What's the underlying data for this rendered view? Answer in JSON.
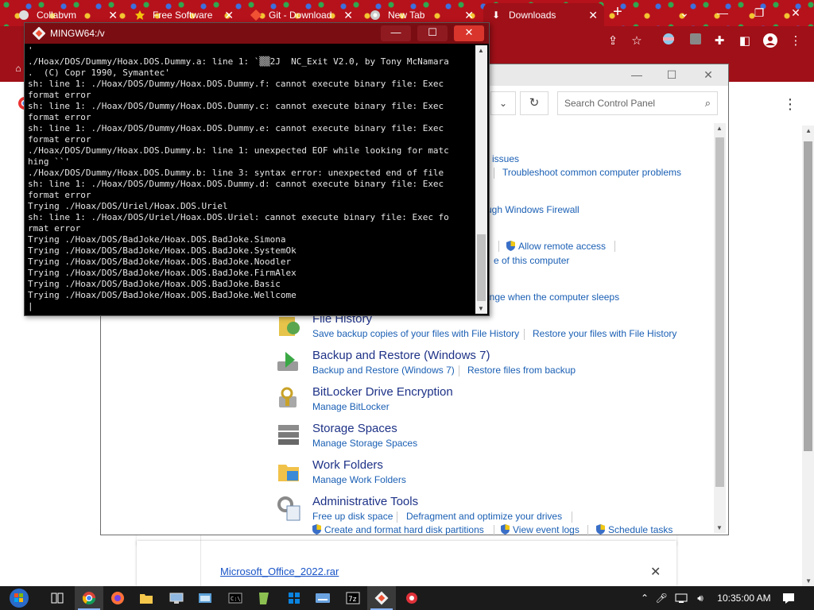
{
  "chrome": {
    "tabs": [
      {
        "label": "Collabvm",
        "icon": "collabvm-favicon"
      },
      {
        "label": "Free Software",
        "icon": "star-favicon"
      },
      {
        "label": "Git - Download",
        "icon": "git-favicon"
      },
      {
        "label": "New Tab",
        "icon": "chrome-favicon"
      },
      {
        "label": "Downloads",
        "icon": "download-favicon"
      }
    ],
    "new_tab": "+",
    "tab_close": "✕"
  },
  "downloads": {
    "file_name": "Microsoft_Office_2022.rar",
    "remove": "✕",
    "menu": "⋮"
  },
  "control_panel": {
    "search_placeholder": "Search Control Panel",
    "links_partial": {
      "issues": "issues",
      "troubleshoot": "Troubleshoot common computer problems",
      "firewall": "ugh Windows Firewall",
      "remote": "Allow remote access",
      "computer_name": "e of this computer",
      "sleep": "ange when the computer sleeps"
    },
    "categories": [
      {
        "title": "File History",
        "links": [
          "Save backup copies of your files with File History",
          "Restore your files with File History"
        ]
      },
      {
        "title": "Backup and Restore (Windows 7)",
        "links": [
          "Backup and Restore (Windows 7)",
          "Restore files from backup"
        ]
      },
      {
        "title": "BitLocker Drive Encryption",
        "links": [
          "Manage BitLocker"
        ]
      },
      {
        "title": "Storage Spaces",
        "links": [
          "Manage Storage Spaces"
        ]
      },
      {
        "title": "Work Folders",
        "links": [
          "Manage Work Folders"
        ]
      },
      {
        "title": "Administrative Tools",
        "links": [
          "Free up disk space",
          "Defragment and optimize your drives",
          "Create and format hard disk partitions",
          "View event logs",
          "Schedule tasks"
        ]
      }
    ]
  },
  "mingw": {
    "title": "MINGW64:/v",
    "lines": [
      "'",
      "./Hoax/DOS/Dummy/Hoax.DOS.Dummy.a: line 1: `▒▒2J  NC_Exit V2.0, by Tony McNamara",
      ".  (C) Copr 1990, Symantec'",
      "sh: line 1: ./Hoax/DOS/Dummy/Hoax.DOS.Dummy.f: cannot execute binary file: Exec",
      "format error",
      "sh: line 1: ./Hoax/DOS/Dummy/Hoax.DOS.Dummy.c: cannot execute binary file: Exec",
      "format error",
      "sh: line 1: ./Hoax/DOS/Dummy/Hoax.DOS.Dummy.e: cannot execute binary file: Exec",
      "format error",
      "./Hoax/DOS/Dummy/Hoax.DOS.Dummy.b: line 1: unexpected EOF while looking for matc",
      "hing ``'",
      "./Hoax/DOS/Dummy/Hoax.DOS.Dummy.b: line 3: syntax error: unexpected end of file",
      "sh: line 1: ./Hoax/DOS/Dummy/Hoax.DOS.Dummy.d: cannot execute binary file: Exec",
      "format error",
      "Trying ./Hoax/DOS/Uriel/Hoax.DOS.Uriel",
      "sh: line 1: ./Hoax/DOS/Uriel/Hoax.DOS.Uriel: cannot execute binary file: Exec fo",
      "rmat error",
      "Trying ./Hoax/DOS/BadJoke/Hoax.DOS.BadJoke.Simona",
      "Trying ./Hoax/DOS/BadJoke/Hoax.DOS.BadJoke.SystemOk",
      "Trying ./Hoax/DOS/BadJoke/Hoax.DOS.BadJoke.Noodler",
      "Trying ./Hoax/DOS/BadJoke/Hoax.DOS.BadJoke.FirmAlex",
      "Trying ./Hoax/DOS/BadJoke/Hoax.DOS.BadJoke.Basic",
      "Trying ./Hoax/DOS/BadJoke/Hoax.DOS.BadJoke.Wellcome",
      "|"
    ]
  },
  "taskbar": {
    "clock": "10:35:00 AM",
    "icons": [
      "start-icon",
      "task-view-icon",
      "chrome-icon",
      "firefox-icon",
      "file-explorer-icon",
      "remote-desktop-icon",
      "control-panel-icon",
      "cmd-icon",
      "notepadplusplus-icon",
      "settings-icon",
      "keyboard-icon",
      "7zip-icon",
      "git-bash-icon",
      "app-icon"
    ]
  }
}
